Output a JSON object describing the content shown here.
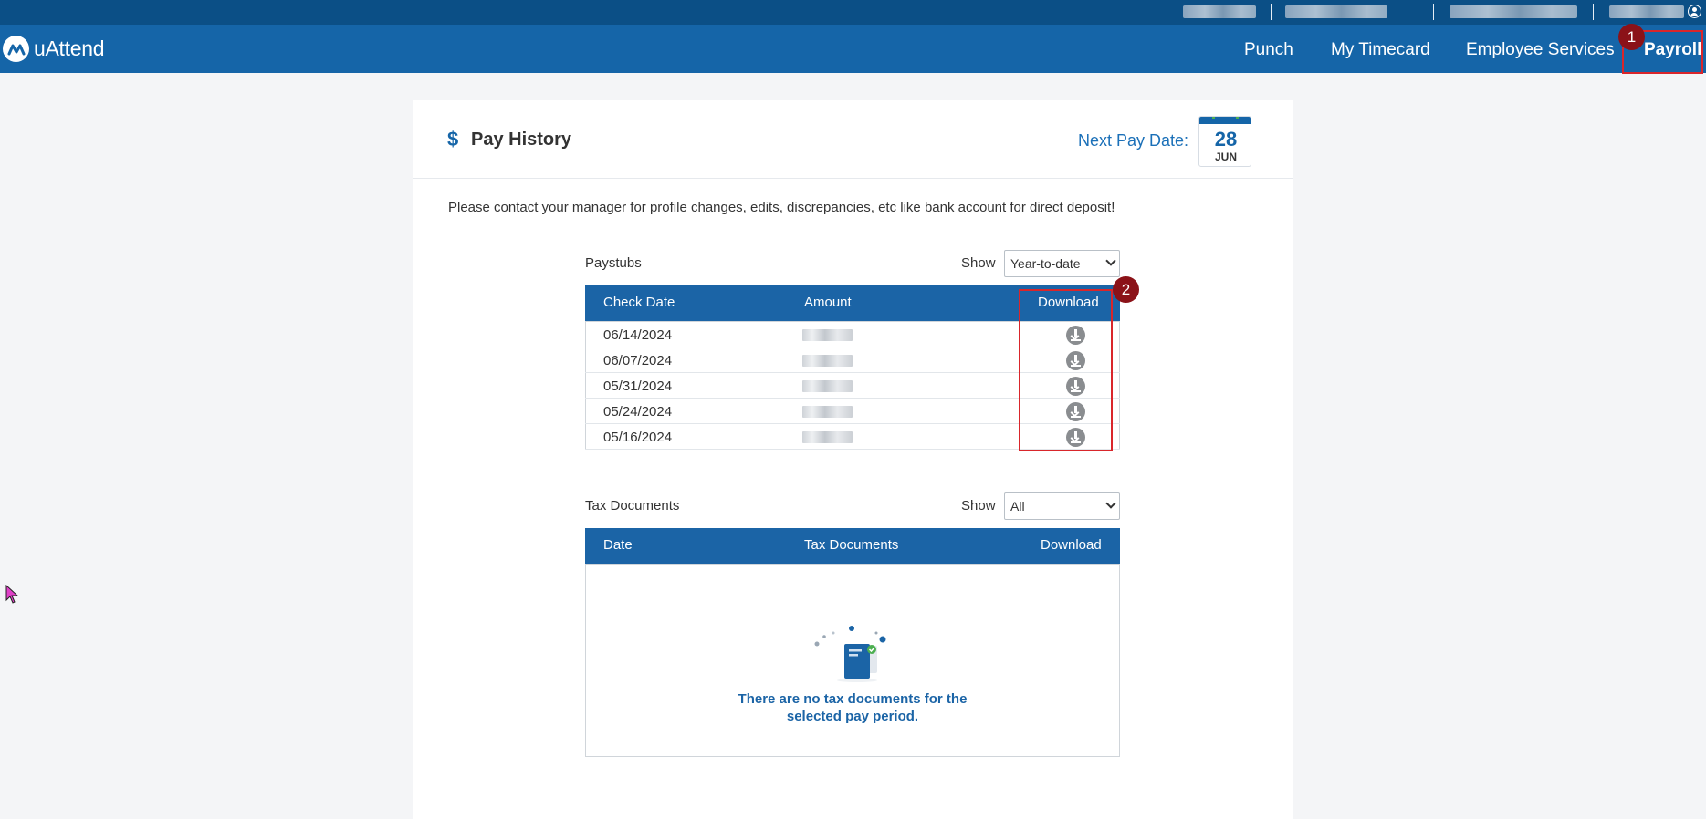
{
  "app": {
    "name": "uAttend"
  },
  "nav": {
    "items": [
      {
        "label": "Punch"
      },
      {
        "label": "My Timecard"
      },
      {
        "label": "Employee Services"
      },
      {
        "label": "Payroll"
      }
    ]
  },
  "annotations": {
    "badge1": "1",
    "badge2": "2"
  },
  "page": {
    "title": "Pay History",
    "title_icon": "dollar-icon",
    "dollar_symbol": "$",
    "next_pay_label": "Next Pay Date:",
    "next_pay_day": "28",
    "next_pay_month": "JUN",
    "notice": "Please contact your manager for profile changes, edits, discrepancies, etc like bank account for direct deposit!"
  },
  "paystubs": {
    "label": "Paystubs",
    "show_label": "Show",
    "filter_value": "Year-to-date",
    "columns": [
      "Check Date",
      "Amount",
      "Download"
    ],
    "rows": [
      {
        "date": "06/14/2024"
      },
      {
        "date": "06/07/2024"
      },
      {
        "date": "05/31/2024"
      },
      {
        "date": "05/24/2024"
      },
      {
        "date": "05/16/2024"
      }
    ]
  },
  "tax_documents": {
    "label": "Tax Documents",
    "show_label": "Show",
    "filter_value": "All",
    "columns": [
      "Date",
      "Tax Documents",
      "Download"
    ],
    "empty_line1": "There are no tax documents for the",
    "empty_line2": "selected pay period."
  },
  "colors": {
    "utility_bar": "#0b4f86",
    "nav_bar": "#1565a8",
    "table_header": "#1b64a6",
    "annotation_red": "#d9262b",
    "badge": "#8b1218"
  }
}
